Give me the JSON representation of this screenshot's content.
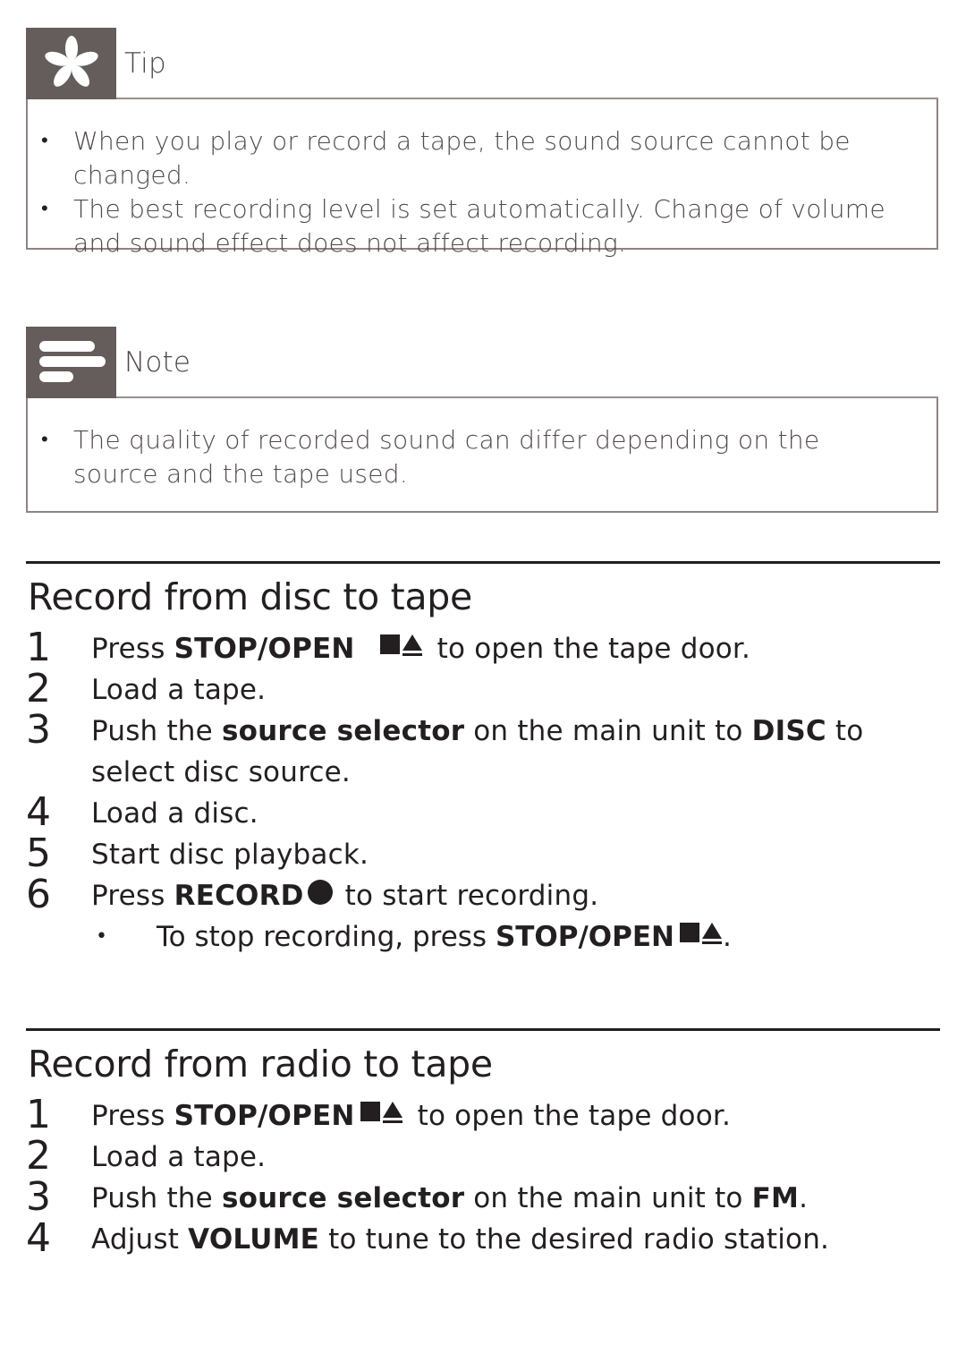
{
  "tip": {
    "label": "Tip",
    "icon": "asterisk-icon",
    "items": [
      "When you play or record a tape, the sound source cannot be changed.",
      "The best recording level is set automatically. Change of volume and sound effect does not affect recording."
    ]
  },
  "note": {
    "label": "Note",
    "icon": "lines-icon",
    "items": [
      "The quality of recorded sound can differ depending on the source and the tape used."
    ]
  },
  "disc_section": {
    "title": "Record from disc to tape",
    "steps": [
      {
        "num": "1",
        "pre": "Press ",
        "bold": "STOP/OPEN",
        "icons": "stop-eject",
        "post": " to open the tape door."
      },
      {
        "num": "2",
        "text": "Load a tape."
      },
      {
        "num": "3",
        "pre": "Push the ",
        "bold": "source selector",
        "mid": " on the main unit to ",
        "bold2": "DISC",
        "post": " to select disc source."
      },
      {
        "num": "4",
        "text": "Load a disc."
      },
      {
        "num": "5",
        "text": "Start disc playback."
      },
      {
        "num": "6",
        "pre": "Press ",
        "bold": "RECORD",
        "icons": "record",
        "post": "to start recording."
      }
    ],
    "sub_step": {
      "pre": "To stop recording, press ",
      "bold": "STOP/OPEN",
      "post": "."
    }
  },
  "radio_section": {
    "title": "Record from radio to tape",
    "steps": [
      {
        "num": "1",
        "pre": "Press ",
        "bold": "STOP/OPEN",
        "icons": "stop-eject",
        "post": " to open the tape door."
      },
      {
        "num": "2",
        "text": "Load a tape."
      },
      {
        "num": "3",
        "pre": "Push the ",
        "bold": "source selector",
        "mid": " on the main unit to ",
        "bold2": "FM",
        "post": "."
      },
      {
        "num": "4",
        "pre": "Adjust ",
        "bold": "VOLUME",
        "post": " to tune to the desired radio station."
      }
    ]
  }
}
